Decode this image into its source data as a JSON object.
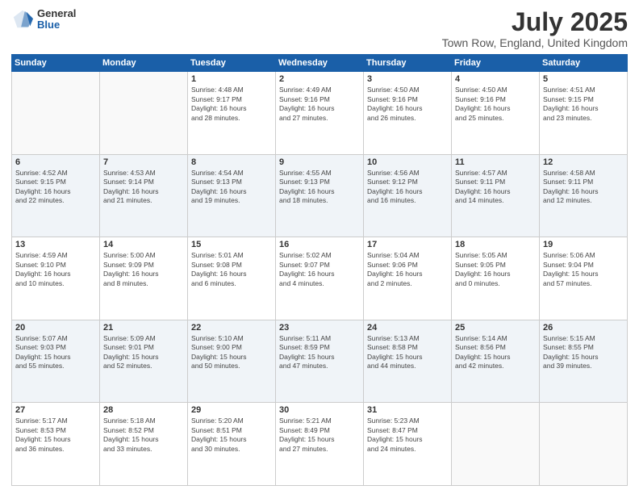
{
  "logo": {
    "general": "General",
    "blue": "Blue"
  },
  "header": {
    "month": "July 2025",
    "location": "Town Row, England, United Kingdom"
  },
  "weekdays": [
    "Sunday",
    "Monday",
    "Tuesday",
    "Wednesday",
    "Thursday",
    "Friday",
    "Saturday"
  ],
  "weeks": [
    [
      {
        "day": null,
        "content": null
      },
      {
        "day": null,
        "content": null
      },
      {
        "day": "1",
        "content": "Sunrise: 4:48 AM\nSunset: 9:17 PM\nDaylight: 16 hours\nand 28 minutes."
      },
      {
        "day": "2",
        "content": "Sunrise: 4:49 AM\nSunset: 9:16 PM\nDaylight: 16 hours\nand 27 minutes."
      },
      {
        "day": "3",
        "content": "Sunrise: 4:50 AM\nSunset: 9:16 PM\nDaylight: 16 hours\nand 26 minutes."
      },
      {
        "day": "4",
        "content": "Sunrise: 4:50 AM\nSunset: 9:16 PM\nDaylight: 16 hours\nand 25 minutes."
      },
      {
        "day": "5",
        "content": "Sunrise: 4:51 AM\nSunset: 9:15 PM\nDaylight: 16 hours\nand 23 minutes."
      }
    ],
    [
      {
        "day": "6",
        "content": "Sunrise: 4:52 AM\nSunset: 9:15 PM\nDaylight: 16 hours\nand 22 minutes."
      },
      {
        "day": "7",
        "content": "Sunrise: 4:53 AM\nSunset: 9:14 PM\nDaylight: 16 hours\nand 21 minutes."
      },
      {
        "day": "8",
        "content": "Sunrise: 4:54 AM\nSunset: 9:13 PM\nDaylight: 16 hours\nand 19 minutes."
      },
      {
        "day": "9",
        "content": "Sunrise: 4:55 AM\nSunset: 9:13 PM\nDaylight: 16 hours\nand 18 minutes."
      },
      {
        "day": "10",
        "content": "Sunrise: 4:56 AM\nSunset: 9:12 PM\nDaylight: 16 hours\nand 16 minutes."
      },
      {
        "day": "11",
        "content": "Sunrise: 4:57 AM\nSunset: 9:11 PM\nDaylight: 16 hours\nand 14 minutes."
      },
      {
        "day": "12",
        "content": "Sunrise: 4:58 AM\nSunset: 9:11 PM\nDaylight: 16 hours\nand 12 minutes."
      }
    ],
    [
      {
        "day": "13",
        "content": "Sunrise: 4:59 AM\nSunset: 9:10 PM\nDaylight: 16 hours\nand 10 minutes."
      },
      {
        "day": "14",
        "content": "Sunrise: 5:00 AM\nSunset: 9:09 PM\nDaylight: 16 hours\nand 8 minutes."
      },
      {
        "day": "15",
        "content": "Sunrise: 5:01 AM\nSunset: 9:08 PM\nDaylight: 16 hours\nand 6 minutes."
      },
      {
        "day": "16",
        "content": "Sunrise: 5:02 AM\nSunset: 9:07 PM\nDaylight: 16 hours\nand 4 minutes."
      },
      {
        "day": "17",
        "content": "Sunrise: 5:04 AM\nSunset: 9:06 PM\nDaylight: 16 hours\nand 2 minutes."
      },
      {
        "day": "18",
        "content": "Sunrise: 5:05 AM\nSunset: 9:05 PM\nDaylight: 16 hours\nand 0 minutes."
      },
      {
        "day": "19",
        "content": "Sunrise: 5:06 AM\nSunset: 9:04 PM\nDaylight: 15 hours\nand 57 minutes."
      }
    ],
    [
      {
        "day": "20",
        "content": "Sunrise: 5:07 AM\nSunset: 9:03 PM\nDaylight: 15 hours\nand 55 minutes."
      },
      {
        "day": "21",
        "content": "Sunrise: 5:09 AM\nSunset: 9:01 PM\nDaylight: 15 hours\nand 52 minutes."
      },
      {
        "day": "22",
        "content": "Sunrise: 5:10 AM\nSunset: 9:00 PM\nDaylight: 15 hours\nand 50 minutes."
      },
      {
        "day": "23",
        "content": "Sunrise: 5:11 AM\nSunset: 8:59 PM\nDaylight: 15 hours\nand 47 minutes."
      },
      {
        "day": "24",
        "content": "Sunrise: 5:13 AM\nSunset: 8:58 PM\nDaylight: 15 hours\nand 44 minutes."
      },
      {
        "day": "25",
        "content": "Sunrise: 5:14 AM\nSunset: 8:56 PM\nDaylight: 15 hours\nand 42 minutes."
      },
      {
        "day": "26",
        "content": "Sunrise: 5:15 AM\nSunset: 8:55 PM\nDaylight: 15 hours\nand 39 minutes."
      }
    ],
    [
      {
        "day": "27",
        "content": "Sunrise: 5:17 AM\nSunset: 8:53 PM\nDaylight: 15 hours\nand 36 minutes."
      },
      {
        "day": "28",
        "content": "Sunrise: 5:18 AM\nSunset: 8:52 PM\nDaylight: 15 hours\nand 33 minutes."
      },
      {
        "day": "29",
        "content": "Sunrise: 5:20 AM\nSunset: 8:51 PM\nDaylight: 15 hours\nand 30 minutes."
      },
      {
        "day": "30",
        "content": "Sunrise: 5:21 AM\nSunset: 8:49 PM\nDaylight: 15 hours\nand 27 minutes."
      },
      {
        "day": "31",
        "content": "Sunrise: 5:23 AM\nSunset: 8:47 PM\nDaylight: 15 hours\nand 24 minutes."
      },
      {
        "day": null,
        "content": null
      },
      {
        "day": null,
        "content": null
      }
    ]
  ]
}
